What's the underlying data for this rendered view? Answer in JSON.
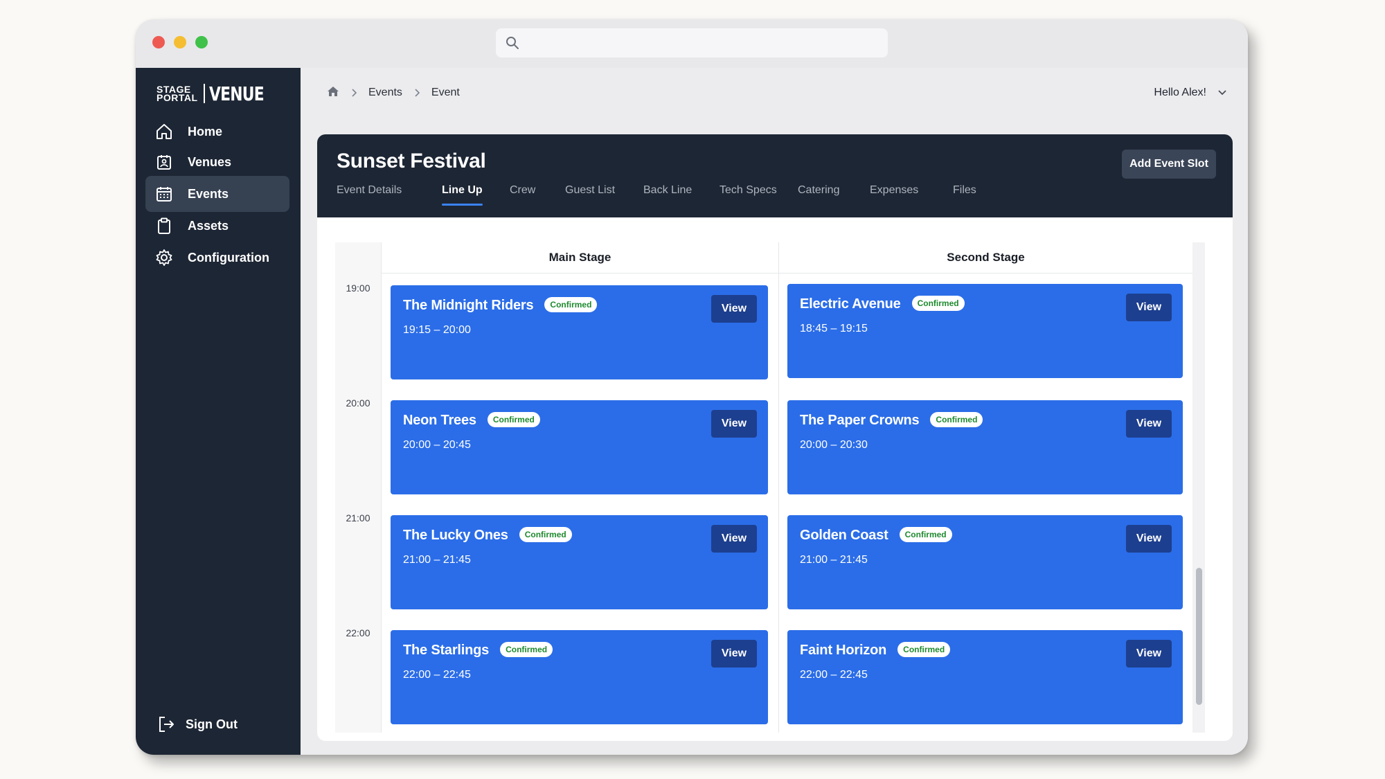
{
  "brand": {
    "stage_line1": "STAGE",
    "stage_line2": "PORTAL",
    "venue": "VENUE"
  },
  "sidebar": {
    "items": [
      {
        "label": "Home",
        "icon": "home-icon"
      },
      {
        "label": "Venues",
        "icon": "venue-icon"
      },
      {
        "label": "Events",
        "icon": "calendar-icon",
        "active": true
      },
      {
        "label": "Assets",
        "icon": "clipboard-icon"
      },
      {
        "label": "Configuration",
        "icon": "gear-icon"
      }
    ],
    "signout_label": "Sign Out"
  },
  "breadcrumb": {
    "items": [
      "Events",
      "Event"
    ]
  },
  "user": {
    "greeting": "Hello Alex!"
  },
  "event": {
    "title": "Sunset Festival",
    "add_slot_label": "Add Event Slot",
    "tabs": [
      "Event Details",
      "Line Up",
      "Crew",
      "Guest List",
      "Back Line",
      "Tech Specs",
      "Catering",
      "Expenses",
      "Files"
    ],
    "active_tab": "Line Up"
  },
  "schedule": {
    "time_labels": [
      "19:00",
      "20:00",
      "21:00",
      "22:00"
    ],
    "stages": [
      {
        "name": "Main Stage",
        "slots": [
          {
            "name": "The Midnight Riders",
            "status": "Confirmed",
            "time": "19:15 – 20:00",
            "action": "View"
          },
          {
            "name": "Neon Trees",
            "status": "Confirmed",
            "time": "20:00 – 20:45",
            "action": "View"
          },
          {
            "name": "The Lucky Ones",
            "status": "Confirmed",
            "time": "21:00 – 21:45",
            "action": "View"
          },
          {
            "name": "The Starlings",
            "status": "Confirmed",
            "time": "22:00 – 22:45",
            "action": "View"
          }
        ]
      },
      {
        "name": "Second Stage",
        "slots": [
          {
            "name": "Electric Avenue",
            "status": "Confirmed",
            "time": "18:45 – 19:15",
            "action": "View"
          },
          {
            "name": "The Paper Crowns",
            "status": "Confirmed",
            "time": "20:00 – 20:30",
            "action": "View"
          },
          {
            "name": "Golden Coast",
            "status": "Confirmed",
            "time": "21:00 – 21:45",
            "action": "View"
          },
          {
            "name": "Faint Horizon",
            "status": "Confirmed",
            "time": "22:00 – 22:45",
            "action": "View"
          }
        ]
      }
    ]
  },
  "colors": {
    "sidebar_bg": "#1d2634",
    "card_blue": "#2b6de8",
    "view_button": "#1d3f8f",
    "badge_text": "#1e8a2e",
    "active_tab_underline": "#3b82f6"
  }
}
